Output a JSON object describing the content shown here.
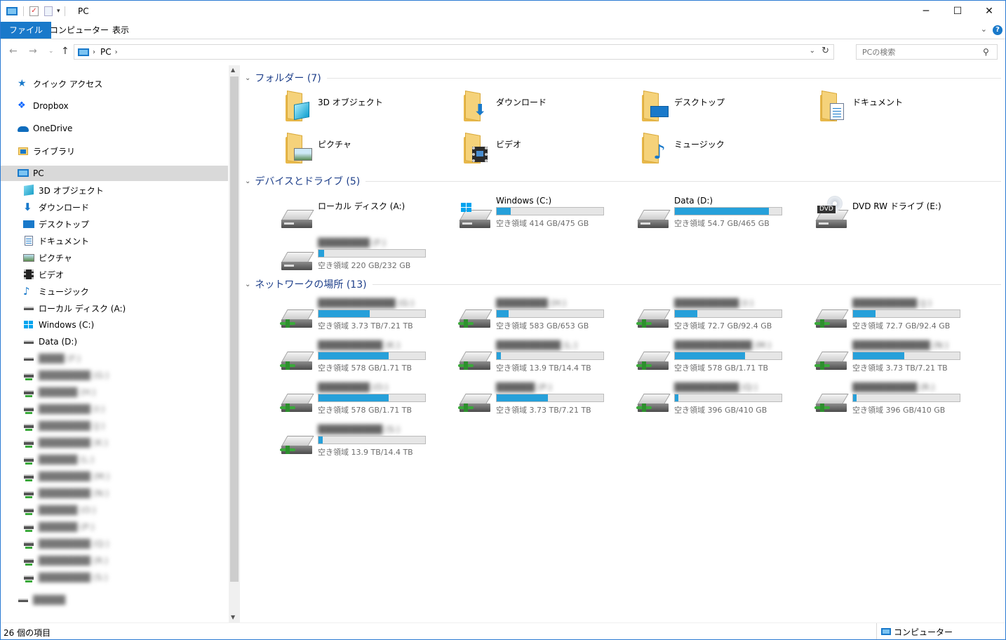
{
  "window": {
    "title": "PC",
    "minimize": "─",
    "maximize": "☐",
    "close": "✕"
  },
  "ribbon": {
    "tabs": [
      "ファイル",
      "コンピューター",
      "表示"
    ],
    "help": "?"
  },
  "address": {
    "crumbs": [
      "PC"
    ],
    "search_placeholder": "PCの検索"
  },
  "nav": {
    "items": [
      {
        "label": "クイック アクセス",
        "icon": "star-icon",
        "level": 0
      },
      {
        "label": "Dropbox",
        "icon": "dropbox-icon",
        "level": 0
      },
      {
        "label": "OneDrive",
        "icon": "cloud-icon",
        "level": 0
      },
      {
        "label": "ライブラリ",
        "icon": "library-icon",
        "level": 0
      },
      {
        "label": "PC",
        "icon": "pc-icon",
        "level": 0,
        "selected": true
      },
      {
        "label": "3D オブジェクト",
        "icon": "cube-icon",
        "level": 1
      },
      {
        "label": "ダウンロード",
        "icon": "download-icon",
        "level": 1
      },
      {
        "label": "デスクトップ",
        "icon": "desktop-icon",
        "level": 1
      },
      {
        "label": "ドキュメント",
        "icon": "document-icon",
        "level": 1
      },
      {
        "label": "ピクチャ",
        "icon": "picture-icon",
        "level": 1
      },
      {
        "label": "ビデオ",
        "icon": "video-icon",
        "level": 1
      },
      {
        "label": "ミュージック",
        "icon": "music-icon",
        "level": 1
      },
      {
        "label": "ローカル ディスク (A:)",
        "icon": "drive-icon",
        "level": 1
      },
      {
        "label": "Windows (C:)",
        "icon": "windows-drive-icon",
        "level": 1
      },
      {
        "label": "Data (D:)",
        "icon": "drive-icon",
        "level": 1
      },
      {
        "label": "████ (F:)",
        "icon": "drive-icon",
        "level": 1,
        "blurred": true
      },
      {
        "label": "████████ (G:)",
        "icon": "network-drive-icon",
        "level": 1,
        "blurred": true
      },
      {
        "label": "██████ (H:)",
        "icon": "network-drive-icon",
        "level": 1,
        "blurred": true
      },
      {
        "label": "████████ (I:)",
        "icon": "network-drive-icon",
        "level": 1,
        "blurred": true
      },
      {
        "label": "████████ (J:)",
        "icon": "network-drive-icon",
        "level": 1,
        "blurred": true
      },
      {
        "label": "████████ (K:)",
        "icon": "network-drive-icon",
        "level": 1,
        "blurred": true
      },
      {
        "label": "██████ (L:)",
        "icon": "network-drive-icon",
        "level": 1,
        "blurred": true
      },
      {
        "label": "████████ (M:)",
        "icon": "network-drive-icon",
        "level": 1,
        "blurred": true
      },
      {
        "label": "████████ (N:)",
        "icon": "network-drive-icon",
        "level": 1,
        "blurred": true
      },
      {
        "label": "██████ (O:)",
        "icon": "network-drive-icon",
        "level": 1,
        "blurred": true
      },
      {
        "label": "██████ (P:)",
        "icon": "network-drive-icon",
        "level": 1,
        "blurred": true
      },
      {
        "label": "████████ (Q:)",
        "icon": "network-drive-icon",
        "level": 1,
        "blurred": true
      },
      {
        "label": "████████ (R:)",
        "icon": "network-drive-icon",
        "level": 1,
        "blurred": true
      },
      {
        "label": "████████ (S:)",
        "icon": "network-drive-icon",
        "level": 1,
        "blurred": true
      },
      {
        "label": "█████",
        "icon": "drive-icon",
        "level": 0,
        "blurred": true
      }
    ]
  },
  "groups": {
    "folders": {
      "title": "フォルダー (7)",
      "items": [
        {
          "label": "3D オブジェクト",
          "glyph": "cube"
        },
        {
          "label": "ダウンロード",
          "glyph": "download"
        },
        {
          "label": "デスクトップ",
          "glyph": "desktop"
        },
        {
          "label": "ドキュメント",
          "glyph": "document"
        },
        {
          "label": "ピクチャ",
          "glyph": "picture"
        },
        {
          "label": "ビデオ",
          "glyph": "video"
        },
        {
          "label": "ミュージック",
          "glyph": "music"
        }
      ]
    },
    "devices": {
      "title": "デバイスとドライブ (5)",
      "items": [
        {
          "label": "ローカル ディスク (A:)",
          "kind": "drive",
          "bar": false
        },
        {
          "label": "Windows (C:)",
          "kind": "windows",
          "bar": true,
          "used": 0.13,
          "free": "空き領域 414 GB/475 GB"
        },
        {
          "label": "Data (D:)",
          "kind": "drive",
          "bar": true,
          "used": 0.88,
          "free": "空き領域 54.7 GB/465 GB"
        },
        {
          "label": "DVD RW ドライブ (E:)",
          "kind": "dvd",
          "bar": false
        },
        {
          "label": "████████ (F:)",
          "kind": "drive",
          "bar": true,
          "used": 0.05,
          "free": "空き領域 220 GB/232 GB",
          "blurred": true
        }
      ]
    },
    "network": {
      "title": "ネットワークの場所 (13)",
      "items": [
        {
          "label": "████████████ (G:)",
          "used": 0.48,
          "free": "空き領域 3.73 TB/7.21 TB"
        },
        {
          "label": "████████ (H:)",
          "used": 0.11,
          "free": "空き領域 583 GB/653 GB"
        },
        {
          "label": "██████████ (I:)",
          "used": 0.21,
          "free": "空き領域 72.7 GB/92.4 GB"
        },
        {
          "label": "██████████ (J:)",
          "used": 0.21,
          "free": "空き領域 72.7 GB/92.4 GB"
        },
        {
          "label": "██████████ (K:)",
          "used": 0.66,
          "free": "空き領域 578 GB/1.71 TB"
        },
        {
          "label": "██████████ (L:)",
          "used": 0.04,
          "free": "空き領域 13.9 TB/14.4 TB"
        },
        {
          "label": "████████████ (M:)",
          "used": 0.66,
          "free": "空き領域 578 GB/1.71 TB"
        },
        {
          "label": "████████████ (N:)",
          "used": 0.48,
          "free": "空き領域 3.73 TB/7.21 TB"
        },
        {
          "label": "████████ (O:)",
          "used": 0.66,
          "free": "空き領域 578 GB/1.71 TB"
        },
        {
          "label": "██████ (P:)",
          "used": 0.48,
          "free": "空き領域 3.73 TB/7.21 TB"
        },
        {
          "label": "██████████ (Q:)",
          "used": 0.03,
          "free": "空き領域 396 GB/410 GB"
        },
        {
          "label": "██████████ (R:)",
          "used": 0.03,
          "free": "空き領域 396 GB/410 GB"
        },
        {
          "label": "██████████ (S:)",
          "used": 0.04,
          "free": "空き領域 13.9 TB/14.4 TB"
        }
      ]
    }
  },
  "status": {
    "count": "26 個の項目",
    "zone": "コンピューター"
  },
  "colors": {
    "accent": "#1979ca",
    "bar_fill": "#26a0da",
    "group_title": "#1e3f8a"
  }
}
